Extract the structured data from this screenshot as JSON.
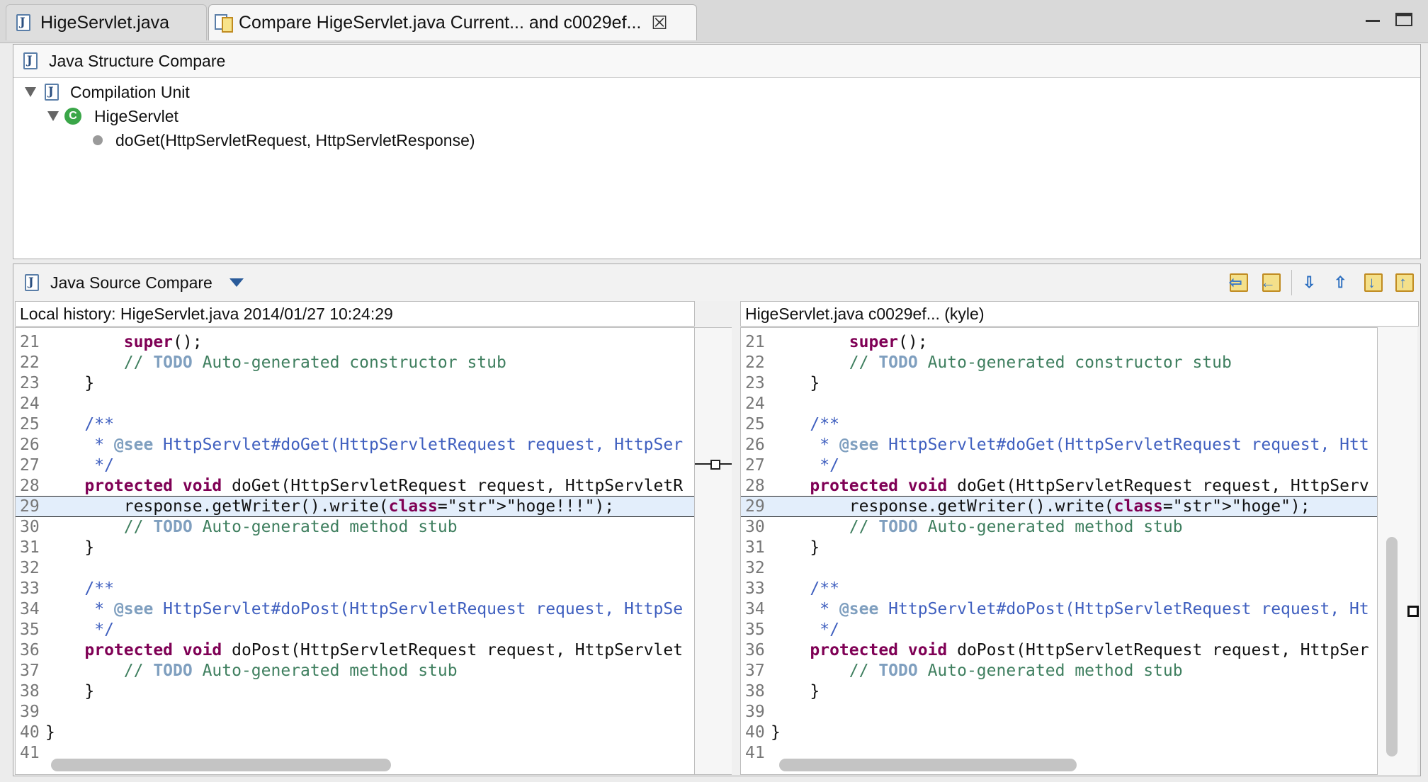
{
  "tabs": [
    {
      "label": "HigeServlet.java",
      "icon": "java-file-icon"
    },
    {
      "label": "Compare HigeServlet.java Current... and c0029ef...",
      "icon": "compare-icon",
      "close_icon": "close-icon"
    }
  ],
  "structure": {
    "title": "Java Structure Compare",
    "tree": [
      {
        "label": "Compilation Unit",
        "icon": "java-file-icon"
      },
      {
        "label": "HigeServlet",
        "icon": "class-icon"
      },
      {
        "label": "doGet(HttpServletRequest, HttpServletResponse)",
        "icon": "method-icon"
      }
    ]
  },
  "source": {
    "title": "Java Source Compare",
    "left_title": "Local history: HigeServlet.java 2014/01/27 10:24:29",
    "right_title": "HigeServlet.java c0029ef... (kyle)",
    "toolbar_icons": [
      "copy-all-left-icon",
      "copy-current-left-icon",
      "next-difference-icon",
      "previous-difference-icon",
      "next-change-icon",
      "previous-change-icon"
    ],
    "line_numbers": [
      "21",
      "22",
      "23",
      "24",
      "25",
      "26",
      "27",
      "28",
      "29",
      "30",
      "31",
      "32",
      "33",
      "34",
      "35",
      "36",
      "37",
      "38",
      "39",
      "40",
      "41"
    ],
    "left_lines": [
      "        super();",
      "        // TODO Auto-generated constructor stub",
      "    }",
      "",
      "    /**",
      "     * @see HttpServlet#doGet(HttpServletRequest request, HttpSer",
      "     */",
      "    protected void doGet(HttpServletRequest request, HttpServletR",
      "        response.getWriter().write(\"hoge!!!\");",
      "        // TODO Auto-generated method stub",
      "    }",
      "",
      "    /**",
      "     * @see HttpServlet#doPost(HttpServletRequest request, HttpSe",
      "     */",
      "    protected void doPost(HttpServletRequest request, HttpServlet",
      "        // TODO Auto-generated method stub",
      "    }",
      "",
      "}",
      ""
    ],
    "right_lines": [
      "        super();",
      "        // TODO Auto-generated constructor stub",
      "    }",
      "",
      "    /**",
      "     * @see HttpServlet#doGet(HttpServletRequest request, Htt",
      "     */",
      "    protected void doGet(HttpServletRequest request, HttpServ",
      "        response.getWriter().write(\"hoge\");",
      "        // TODO Auto-generated method stub",
      "    }",
      "",
      "    /**",
      "     * @see HttpServlet#doPost(HttpServletRequest request, Ht",
      "     */",
      "    protected void doPost(HttpServletRequest request, HttpSer",
      "        // TODO Auto-generated method stub",
      "    }",
      "",
      "}",
      ""
    ],
    "changed_line": "29"
  }
}
